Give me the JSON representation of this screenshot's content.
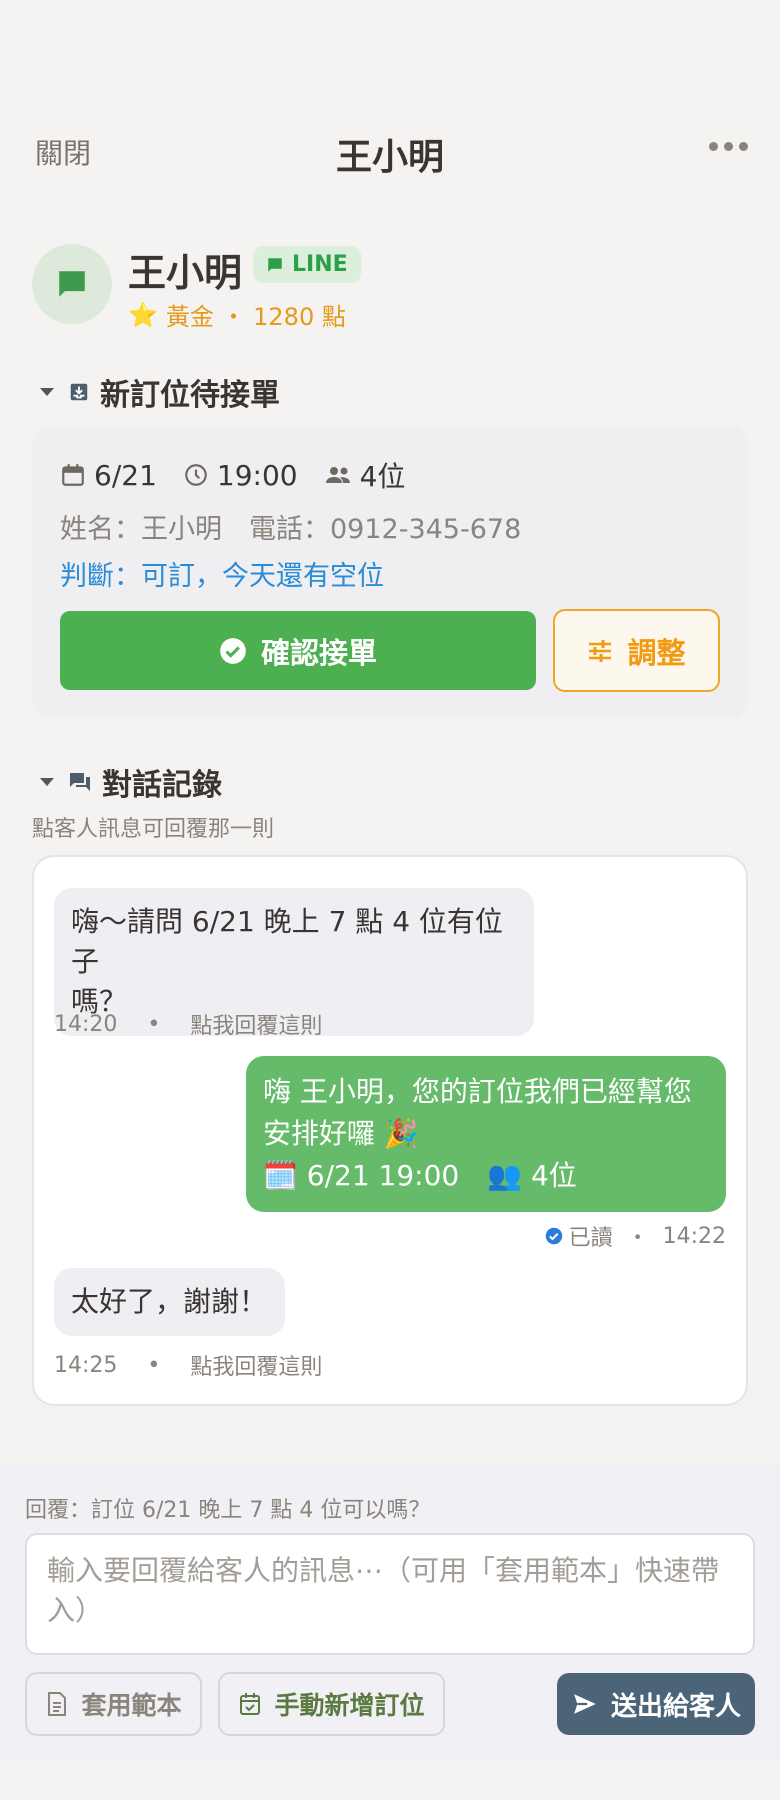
{
  "header": {
    "close_label": "關閉",
    "title": "王小明",
    "more_icon": "more-icon"
  },
  "profile": {
    "name": "王小明",
    "channel_badge": "LINE",
    "tier_icon": "⭐",
    "tier_text": "黃金 ・ 1280 點",
    "colors": {
      "line_green": "#2aa048",
      "tier_gold": "#e59a1a"
    }
  },
  "order_section": {
    "title": "新訂位待接單",
    "date": "6/21",
    "time": "19:00",
    "party": "4位",
    "contact": "姓名：王小明　電話：0912-345-678",
    "judgement": "判斷：可訂，今天還有空位",
    "confirm_label": "確認接單",
    "adjust_label": "調整",
    "colors": {
      "confirm": "#4caf50",
      "adjust": "#f29a12",
      "judgement": "#2a8bd6"
    }
  },
  "chat_section": {
    "title": "對話記錄",
    "subtitle": "點客人訊息可回覆那一則",
    "messages": [
      {
        "direction": "in",
        "text_line1": "嗨～請問 6/21 晚上 7 點 4 位有位子",
        "text_line2": "嗎？",
        "time": "14:20",
        "dot": "•",
        "action": "點我回覆這則"
      },
      {
        "direction": "out",
        "text_line1": "嗨 王小明，您的訂位我們已經幫您",
        "text_line2": "安排好囉 🎉",
        "text_line3": "🗓️ 6/21 19:00　👥 4位",
        "status": "已讀",
        "dot": "・",
        "time": "14:22"
      },
      {
        "direction": "in",
        "text_line1": "太好了，謝謝！",
        "time": "14:25",
        "dot": "•",
        "action": "點我回覆這則"
      }
    ]
  },
  "composer": {
    "reply_to": "回覆：訂位 6/21 晚上 7 點 4 位可以嗎？",
    "placeholder": "輸入要回覆給客人的訊息⋯（可用「套用範本」快速帶入）",
    "template_label": "套用範本",
    "manual_label": "手動新增訂位",
    "send_label": "送出給客人",
    "colors": {
      "send_bg": "#4b6478"
    }
  }
}
